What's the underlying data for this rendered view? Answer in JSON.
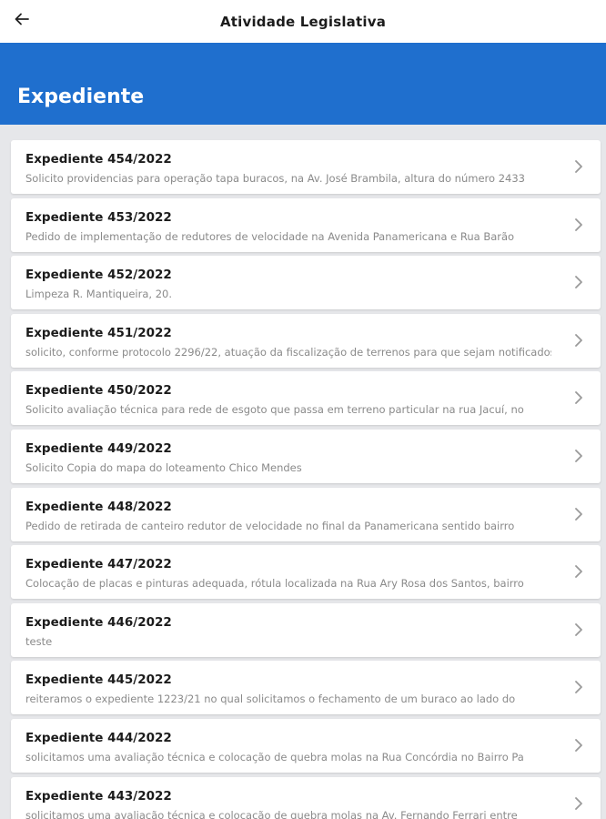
{
  "header": {
    "title": "Atividade Legislativa",
    "back_icon": "arrow-left-icon"
  },
  "banner": {
    "title": "Expediente",
    "color": "#1f6fce"
  },
  "items": [
    {
      "title": "Expediente 454/2022",
      "description": "Solicito providencias para operação tapa buracos, na Av. José Brambila, altura do número 2433"
    },
    {
      "title": "Expediente 453/2022",
      "description": "Pedido de implementação de redutores de velocidade na Avenida Panamericana e Rua Barão"
    },
    {
      "title": "Expediente 452/2022",
      "description": "Limpeza R. Mantiqueira, 20."
    },
    {
      "title": "Expediente 451/2022",
      "description": "solicito, conforme protocolo 2296/22, atuação da fiscalização de terrenos para que sejam notificados"
    },
    {
      "title": "Expediente 450/2022",
      "description": "Solicito avaliação técnica para rede de esgoto que passa em terreno particular na rua Jacuí, no"
    },
    {
      "title": "Expediente 449/2022",
      "description": "Solicito Copia do mapa do loteamento Chico Mendes"
    },
    {
      "title": "Expediente 448/2022",
      "description": "Pedido de retirada de canteiro redutor de velocidade no final da Panamericana sentido bairro"
    },
    {
      "title": "Expediente 447/2022",
      "description": "Colocação de placas e pinturas adequada, rótula localizada na Rua Ary Rosa dos Santos, bairro"
    },
    {
      "title": "Expediente 446/2022",
      "description": "teste"
    },
    {
      "title": "Expediente 445/2022",
      "description": "reiteramos o expediente 1223/21 no qual solicitamos o fechamento de um buraco ao lado do"
    },
    {
      "title": "Expediente 444/2022",
      "description": "solicitamos uma avaliação técnica e colocação de quebra molas na Rua Concórdia no Bairro Pa"
    },
    {
      "title": "Expediente 443/2022",
      "description": "solicitamos uma avaliação técnica e colocação de quebra molas na Av. Fernando Ferrari entre"
    }
  ],
  "item_icon": "chevron-right-icon"
}
